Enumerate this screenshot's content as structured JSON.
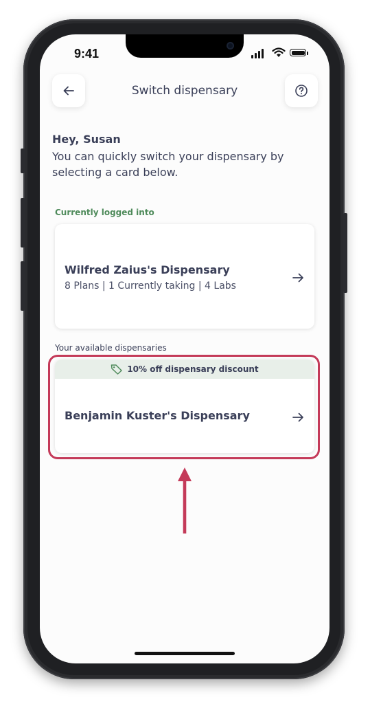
{
  "status_bar": {
    "time": "9:41"
  },
  "header": {
    "title": "Switch dispensary",
    "back_icon": "arrow-left-icon",
    "help_icon": "question-circle-icon"
  },
  "greeting": {
    "title": "Hey, Susan",
    "body": "You can quickly switch your dispensary by selecting a card below."
  },
  "current": {
    "section_label": "Currently logged into",
    "name": "Wilfred Zaius's Dispensary",
    "meta": "8 Plans | 1 Currently taking | 4 Labs"
  },
  "available": {
    "section_label": "Your available dispensaries",
    "items": [
      {
        "discount": "10% off dispensary discount",
        "name": "Benjamin Kuster's Dispensary"
      }
    ]
  },
  "colors": {
    "accent_green": "#4e8a5a",
    "discount_bg": "#e8efe9",
    "highlight": "#c43a59",
    "text_primary": "#3a3f58"
  }
}
